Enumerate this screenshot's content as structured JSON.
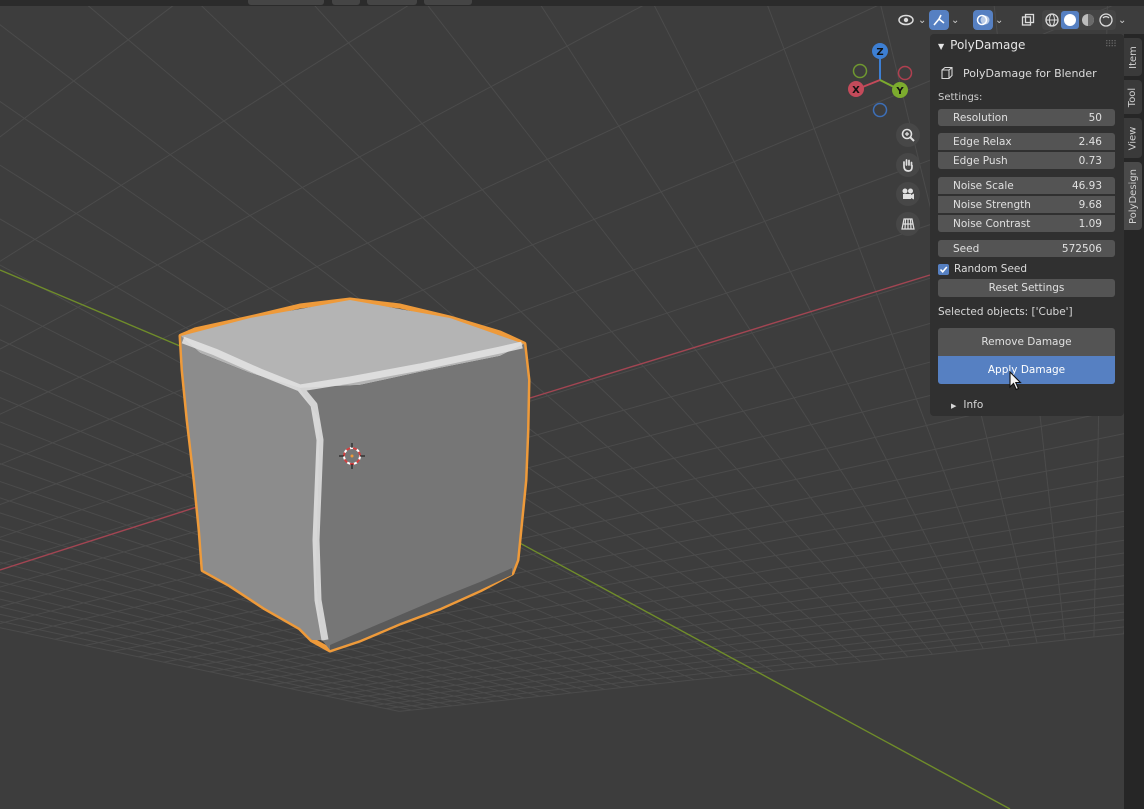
{
  "colors": {
    "background": "#3d3d3d",
    "grid_line": "#4b4b4b",
    "x_axis": "#a24552",
    "y_axis": "#6f8c2a",
    "selection_outline": "#ee9a3a",
    "accent": "#5680c2",
    "panel": "#303030",
    "field": "#545454"
  },
  "viewport_header": {
    "icons": [
      "visibility-icon",
      "gizmo-icon",
      "overlay-icon",
      "xray-icon",
      "wireframe-shading-icon",
      "solid-shading-icon",
      "material-shading-icon",
      "rendered-shading-icon"
    ]
  },
  "gizmo": {
    "z_label": "Z",
    "x_label": "X",
    "y_label": "Y"
  },
  "panel": {
    "title": "PolyDamage",
    "subtitle": "PolyDamage for Blender",
    "settings_label": "Settings:",
    "fields": [
      {
        "label": "Resolution",
        "value": "50"
      },
      {
        "label": "Edge Relax",
        "value": "2.46"
      },
      {
        "label": "Edge Push",
        "value": "0.73"
      },
      {
        "label": "Noise Scale",
        "value": "46.93"
      },
      {
        "label": "Noise Strength",
        "value": "9.68"
      },
      {
        "label": "Noise Contrast",
        "value": "1.09"
      },
      {
        "label": "Seed",
        "value": "572506"
      }
    ],
    "random_seed_label": "Random Seed",
    "random_seed_checked": true,
    "reset_label": "Reset Settings",
    "selected_text": "Selected objects: ['Cube']",
    "remove_label": "Remove Damage",
    "apply_label": "Apply Damage",
    "info_label": "Info"
  },
  "tabs": [
    "Item",
    "Tool",
    "View",
    "PolyDesign"
  ],
  "active_tab": "PolyDesign"
}
